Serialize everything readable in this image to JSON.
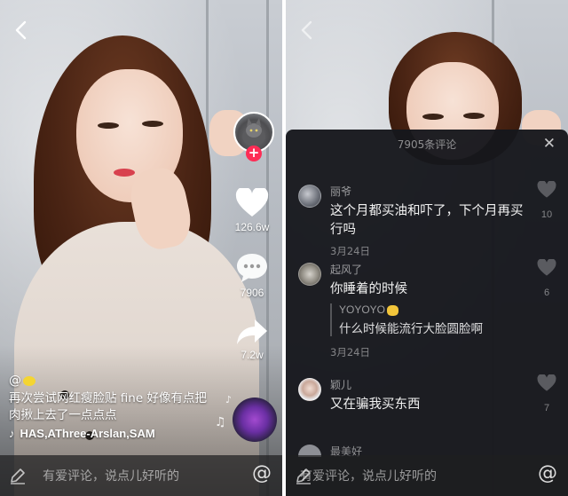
{
  "left": {
    "author_handle": "@",
    "description": "再次尝试网红瘦脸贴 fine 好像有点把肉揪上去了一点点点",
    "music": "HAS,AThree-Arslan,SAM",
    "likes": "126.6w",
    "comments": "7906",
    "shares": "7.2w",
    "comment_placeholder": "有爱评论，说点儿好听的",
    "at_symbol": "@"
  },
  "right": {
    "sheet_title": "7905条评论",
    "close_symbol": "✕",
    "comments": [
      {
        "user": "丽爷",
        "text": "这个月都买油和吓了，下个月再买行吗",
        "date": "3月24日",
        "likes": "10"
      },
      {
        "user": "起风了",
        "text": "你睡着的时候",
        "date": "3月24日",
        "likes": "6",
        "reply": {
          "user": "YOYOYO",
          "text": "什么时候能流行大脸圆脸啊"
        }
      },
      {
        "user": "颖儿",
        "text": "又在骗我买东西",
        "date": "",
        "likes": "7"
      }
    ],
    "partial_user": "最美好",
    "comment_placeholder": "有爱评论，说点儿好听的",
    "at_symbol": "@"
  },
  "icons": [
    "back-arrow-icon",
    "heart-icon",
    "comment-bubble-icon",
    "share-arrow-icon",
    "music-note-icon",
    "pen-icon",
    "close-icon"
  ],
  "colors": {
    "accent": "#fe2c55",
    "sheet_bg": "#16171c",
    "text_muted": "#8c8c8f"
  }
}
